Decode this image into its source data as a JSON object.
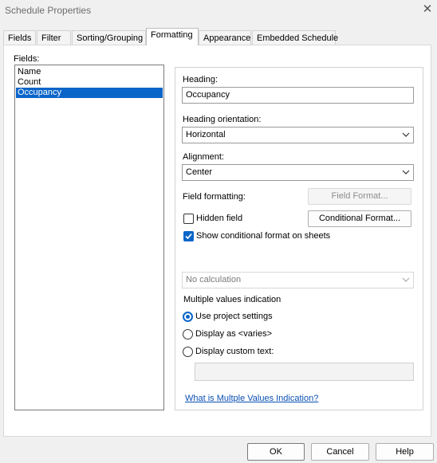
{
  "window": {
    "title": "Schedule Properties"
  },
  "tabs": [
    {
      "label": "Fields"
    },
    {
      "label": "Filter"
    },
    {
      "label": "Sorting/Grouping"
    },
    {
      "label": "Formatting",
      "active": true
    },
    {
      "label": "Appearance"
    },
    {
      "label": "Embedded Schedule"
    }
  ],
  "fields": {
    "label": "Fields:",
    "items": [
      "Name",
      "Count",
      "Occupancy"
    ],
    "selected": "Occupancy"
  },
  "heading": {
    "label": "Heading:",
    "value": "Occupancy"
  },
  "heading_orientation": {
    "label": "Heading orientation:",
    "value": "Horizontal"
  },
  "alignment": {
    "label": "Alignment:",
    "value": "Center"
  },
  "field_formatting": {
    "label": "Field formatting:",
    "button": "Field Format..."
  },
  "hidden_field": {
    "label": "Hidden field",
    "checked": false
  },
  "conditional_format": {
    "button": "Conditional  Format..."
  },
  "show_conditional": {
    "label": "Show conditional format on sheets",
    "checked": true
  },
  "calculation": {
    "value": "No calculation"
  },
  "multiple_values": {
    "label": "Multiple values indication",
    "options": [
      {
        "label": "Use project settings",
        "checked": true
      },
      {
        "label": "Display as <varies>",
        "checked": false
      },
      {
        "label": "Display custom text:",
        "checked": false
      }
    ],
    "custom_text": "",
    "help_link": "What is Multple Values Indication?"
  },
  "footer": {
    "ok": "OK",
    "cancel": "Cancel",
    "help": "Help"
  },
  "colors": {
    "accent": "#0a65c9",
    "link": "#0a4fb3"
  }
}
